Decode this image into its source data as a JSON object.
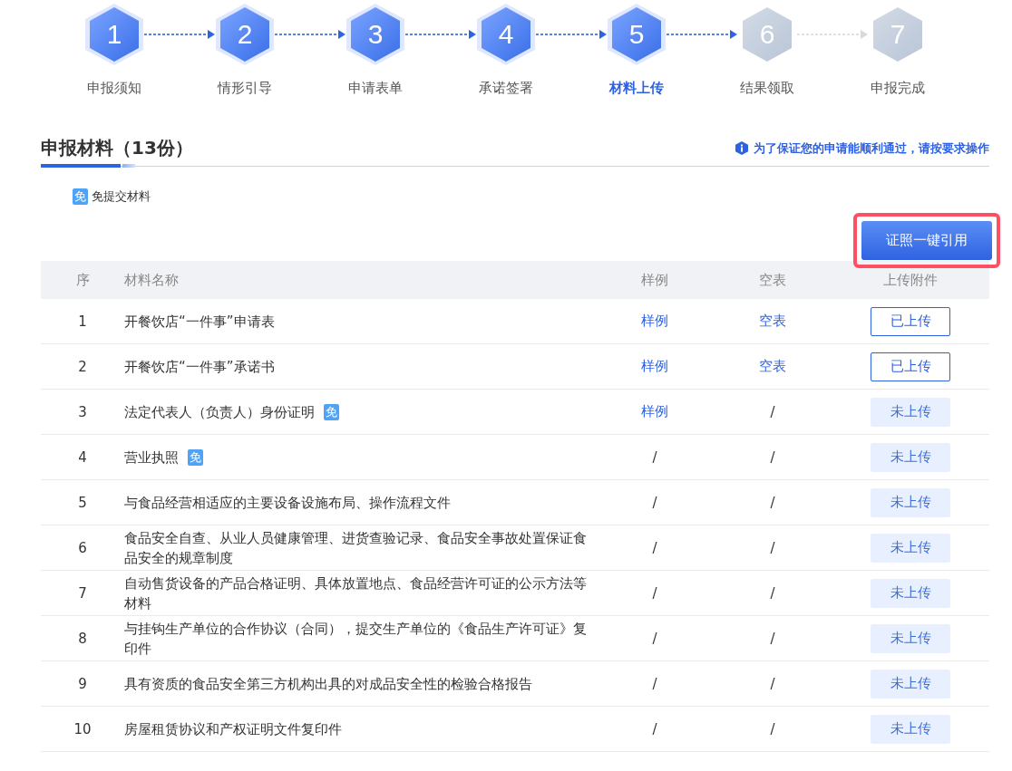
{
  "steps": [
    {
      "number": "1",
      "label": "申报须知",
      "kind": "reached",
      "selected": false
    },
    {
      "number": "2",
      "label": "情形引导",
      "kind": "reached",
      "selected": false
    },
    {
      "number": "3",
      "label": "申请表单",
      "kind": "reached",
      "selected": false
    },
    {
      "number": "4",
      "label": "承诺签署",
      "kind": "reached",
      "selected": false
    },
    {
      "number": "5",
      "label": "材料上传",
      "kind": "reached",
      "selected": true
    },
    {
      "number": "6",
      "label": "结果领取",
      "kind": "pending",
      "selected": false
    },
    {
      "number": "7",
      "label": "申报完成",
      "kind": "pending",
      "selected": false
    }
  ],
  "section": {
    "title": "申报材料（13份）",
    "notice": "为了保证您的申请能顺利通过，请按要求操作"
  },
  "legend": {
    "badge": "免",
    "label": "免提交材料"
  },
  "quote_button": {
    "label": "证照一键引用",
    "highlighted": true
  },
  "table": {
    "columns": [
      "序",
      "材料名称",
      "样例",
      "空表",
      "上传附件"
    ],
    "rows": [
      {
        "index": "1",
        "name": "开餐饮店“一件事”申请表",
        "sample": {
          "kind": "link",
          "text": "样例"
        },
        "blank": {
          "kind": "link",
          "text": "空表"
        },
        "upload": {
          "label": "已上传",
          "uploaded": true
        }
      },
      {
        "index": "2",
        "name": "开餐饮店“一件事”承诺书",
        "sample": {
          "kind": "link",
          "text": "样例"
        },
        "blank": {
          "kind": "link",
          "text": "空表"
        },
        "upload": {
          "label": "已上传",
          "uploaded": true
        }
      },
      {
        "index": "3",
        "name": "法定代表人（负责人）身份证明",
        "badge": "免",
        "sample": {
          "kind": "link",
          "text": "样例"
        },
        "blank": {
          "kind": "none",
          "text": "/"
        },
        "upload": {
          "label": "未上传",
          "uploaded": false
        }
      },
      {
        "index": "4",
        "name": "营业执照",
        "badge": "免",
        "sample": {
          "kind": "none",
          "text": "/"
        },
        "blank": {
          "kind": "none",
          "text": "/"
        },
        "upload": {
          "label": "未上传",
          "uploaded": false
        }
      },
      {
        "index": "5",
        "name": "与食品经营相适应的主要设备设施布局、操作流程文件",
        "sample": {
          "kind": "none",
          "text": "/"
        },
        "blank": {
          "kind": "none",
          "text": "/"
        },
        "upload": {
          "label": "未上传",
          "uploaded": false
        }
      },
      {
        "index": "6",
        "name": "食品安全自查、从业人员健康管理、进货查验记录、食品安全事故处置保证食品安全的规章制度",
        "sample": {
          "kind": "none",
          "text": "/"
        },
        "blank": {
          "kind": "none",
          "text": "/"
        },
        "upload": {
          "label": "未上传",
          "uploaded": false
        }
      },
      {
        "index": "7",
        "name": "自动售货设备的产品合格证明、具体放置地点、食品经营许可证的公示方法等材料",
        "sample": {
          "kind": "none",
          "text": "/"
        },
        "blank": {
          "kind": "none",
          "text": "/"
        },
        "upload": {
          "label": "未上传",
          "uploaded": false
        }
      },
      {
        "index": "8",
        "name": "与挂钩生产单位的合作协议（合同），提交生产单位的《食品生产许可证》复印件",
        "sample": {
          "kind": "none",
          "text": "/"
        },
        "blank": {
          "kind": "none",
          "text": "/"
        },
        "upload": {
          "label": "未上传",
          "uploaded": false
        }
      },
      {
        "index": "9",
        "name": "具有资质的食品安全第三方机构出具的对成品安全性的检验合格报告",
        "sample": {
          "kind": "none",
          "text": "/"
        },
        "blank": {
          "kind": "none",
          "text": "/"
        },
        "upload": {
          "label": "未上传",
          "uploaded": false
        }
      },
      {
        "index": "10",
        "name": "房屋租赁协议和产权证明文件复印件",
        "sample": {
          "kind": "none",
          "text": "/"
        },
        "blank": {
          "kind": "none",
          "text": "/"
        },
        "upload": {
          "label": "未上传",
          "uploaded": false
        }
      }
    ]
  }
}
